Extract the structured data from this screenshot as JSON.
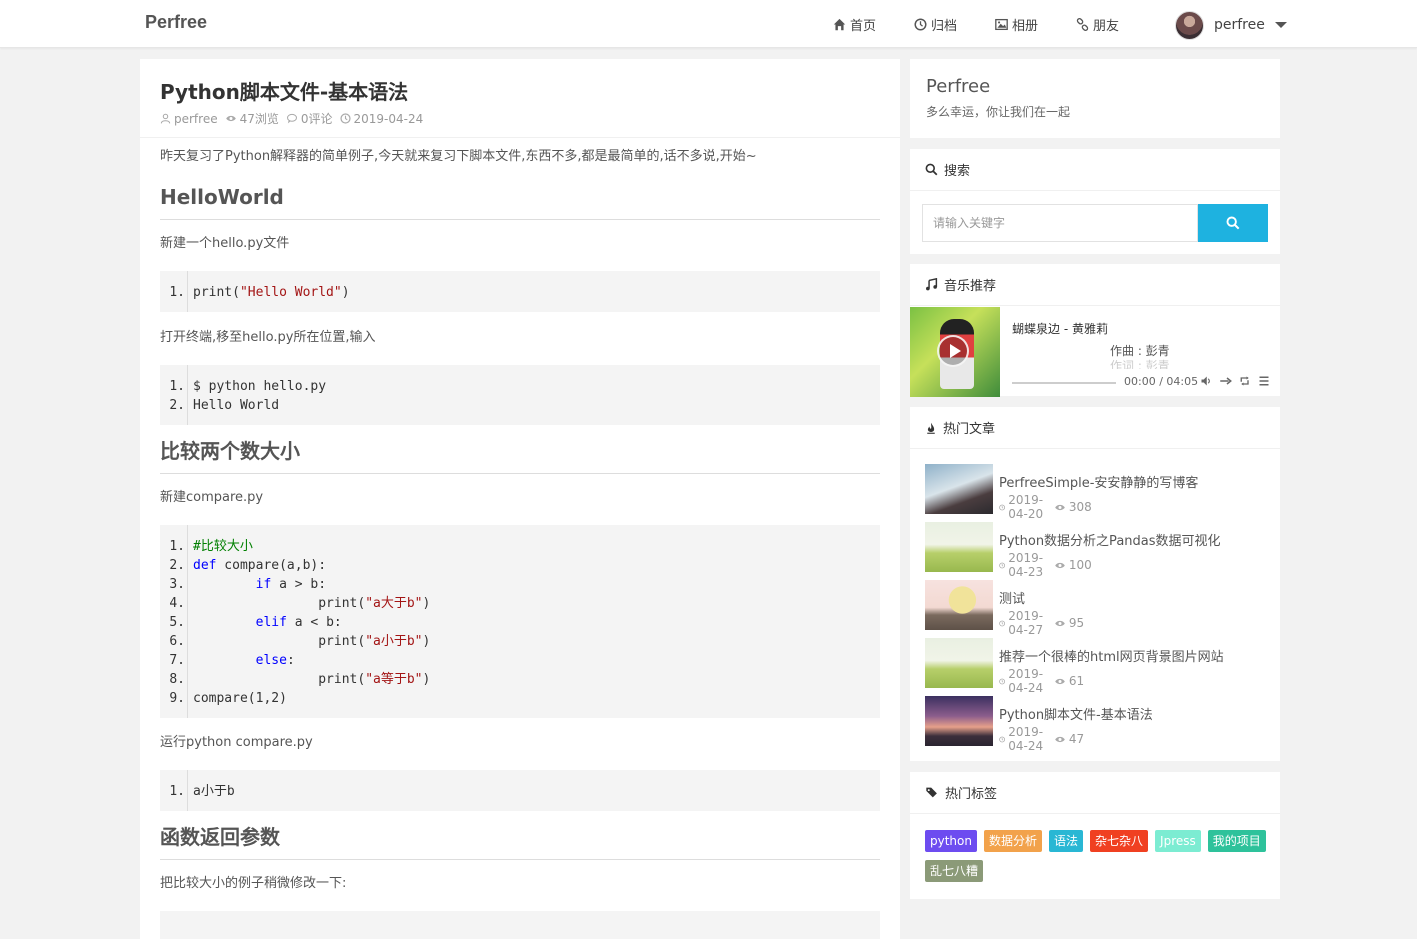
{
  "header": {
    "brand": "Perfree",
    "nav": [
      {
        "label": "首页",
        "icon": "home-icon"
      },
      {
        "label": "归档",
        "icon": "clock-icon"
      },
      {
        "label": "相册",
        "icon": "image-icon"
      },
      {
        "label": "朋友",
        "icon": "link-icon"
      }
    ],
    "user": {
      "name": "perfree"
    }
  },
  "article": {
    "title": "Python脚本文件-基本语法",
    "meta": {
      "author": "perfree",
      "views": "47浏览",
      "comments": "0评论",
      "date": "2019-04-24"
    },
    "intro": "昨天复习了Python解释器的简单例子,今天就来复习下脚本文件,东西不多,都是最简单的,话不多说,开始~",
    "sections": {
      "hello_heading": "HelloWorld",
      "hello_p1": "新建一个hello.py文件",
      "hello_p2": "打开终端,移至hello.py所在位置,输入",
      "compare_heading": "比较两个数大小",
      "compare_p1": "新建compare.py",
      "compare_p2": "运行python compare.py",
      "return_heading": "函数返回参数",
      "return_p1": "把比较大小的例子稍微修改一下:"
    },
    "code1": [
      {
        "n": "1.",
        "pre": "print(",
        "str": "\"Hello World\"",
        "post": ")"
      }
    ],
    "code2": [
      {
        "n": "1.",
        "text": "$ python hello.py"
      },
      {
        "n": "2.",
        "text": "Hello World"
      }
    ],
    "code3": [
      {
        "n": "1.",
        "cmt": "#比较大小"
      },
      {
        "n": "2.",
        "kw": "def",
        "rest": " compare(a,b):"
      },
      {
        "n": "3.",
        "indent": "        ",
        "kw": "if",
        "rest": " a > b:"
      },
      {
        "n": "4.",
        "indent": "                ",
        "pre": "print(",
        "str": "\"a大于b\"",
        "post": ")"
      },
      {
        "n": "5.",
        "indent": "        ",
        "kw": "elif",
        "rest": " a < b:"
      },
      {
        "n": "6.",
        "indent": "                ",
        "pre": "print(",
        "str": "\"a小于b\"",
        "post": ")"
      },
      {
        "n": "7.",
        "indent": "        ",
        "kw": "else",
        "rest": ":"
      },
      {
        "n": "8.",
        "indent": "                ",
        "pre": "print(",
        "str": "\"a等于b\"",
        "post": ")"
      },
      {
        "n": "9.",
        "text": "compare(1,2)"
      }
    ],
    "code4": [
      {
        "n": "1.",
        "text": "a小于b"
      }
    ]
  },
  "sidebar": {
    "blog": {
      "title": "Perfree",
      "subtitle": "多么幸运，你让我们在一起"
    },
    "search": {
      "heading": "搜索",
      "placeholder": "请输入关键字"
    },
    "music": {
      "heading": "音乐推荐",
      "song": "蝴蝶泉边 - 黄雅莉",
      "lyric_line1": "作曲 : 彭青",
      "lyric_line2": "作词 : 彭青",
      "time": "00:00 / 04:05",
      "progress": 0
    },
    "hot": {
      "heading": "热门文章",
      "items": [
        {
          "title": "PerfreeSimple-安安静静的写博客",
          "date": "2019-04-20",
          "views": "308"
        },
        {
          "title": "Python数据分析之Pandas数据可视化",
          "date": "2019-04-23",
          "views": "100"
        },
        {
          "title": "测试",
          "date": "2019-04-27",
          "views": "95"
        },
        {
          "title": "推荐一个很棒的html网页背景图片网站",
          "date": "2019-04-24",
          "views": "61"
        },
        {
          "title": "Python脚本文件-基本语法",
          "date": "2019-04-24",
          "views": "47"
        }
      ]
    },
    "tags": {
      "heading": "热门标签",
      "items": [
        {
          "label": "python",
          "color": "#6d4cf0"
        },
        {
          "label": "数据分析",
          "color": "#f2a24b"
        },
        {
          "label": "语法",
          "color": "#29b7d4"
        },
        {
          "label": "杂七杂八",
          "color": "#f04021"
        },
        {
          "label": "Jpress",
          "color": "#7cecd2"
        },
        {
          "label": "我的项目",
          "color": "#2ec29b"
        },
        {
          "label": "乱七八糟",
          "color": "#8b9a78"
        }
      ]
    }
  },
  "colors": {
    "accent": "#1eb2e0",
    "background": "#f2f2f2"
  }
}
